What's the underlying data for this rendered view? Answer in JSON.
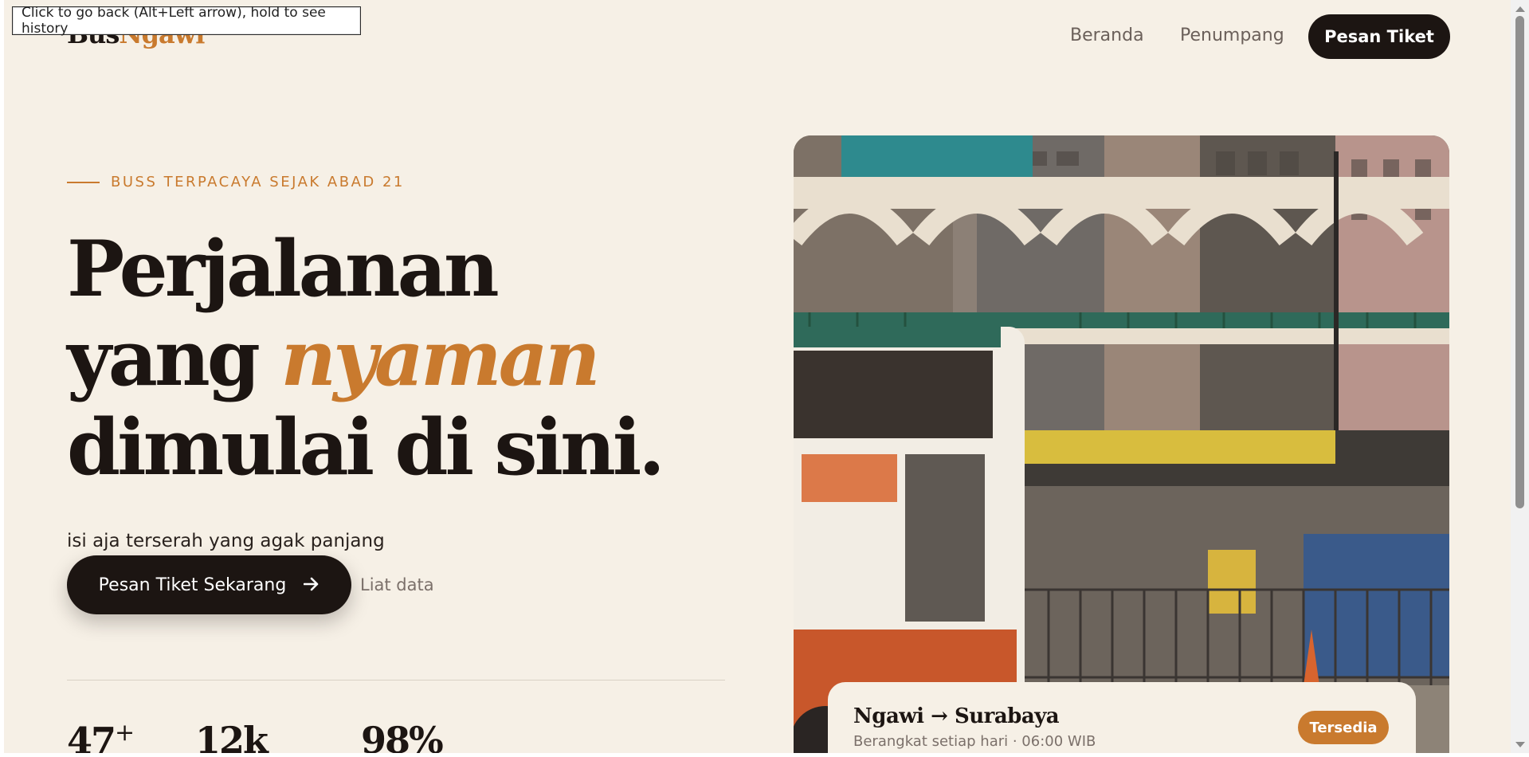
{
  "browser": {
    "tooltip": "Click to go back (Alt+Left arrow), hold to see history"
  },
  "nav": {
    "logo_part1": "Bus",
    "logo_part2": "Ngawi",
    "links": [
      {
        "label": "Beranda"
      },
      {
        "label": "Penumpang"
      }
    ],
    "cta_label": "Pesan Tiket"
  },
  "hero": {
    "eyebrow": "BUSS TERPACAYA SEJAK ABAD 21",
    "headline_line1": "Perjalanan",
    "headline_line2_a": "yang ",
    "headline_line2_b": "nyaman",
    "headline_line3": "dimulai di sini.",
    "subtitle": "isi aja terserah yang agak panjang",
    "primary_cta": "Pesan Tiket Sekarang",
    "primary_cta_icon": "arrow-right-icon",
    "secondary_cta": "Liat data",
    "stats": [
      {
        "value": "47",
        "suffix": "+"
      },
      {
        "value": "12k",
        "suffix": ""
      },
      {
        "value": "98%",
        "suffix": ""
      }
    ]
  },
  "route_card": {
    "title": "Ngawi → Surabaya",
    "subtitle": "Berangkat setiap hari · 06:00 WIB",
    "badge": "Tersedia"
  },
  "colors": {
    "background": "#f6f0e6",
    "ink": "#1c1512",
    "accent": "#c97a2e",
    "muted": "#7b706a"
  }
}
